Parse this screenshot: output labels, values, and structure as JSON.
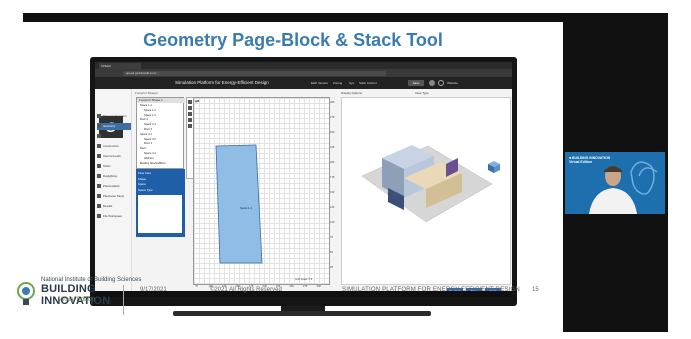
{
  "slide": {
    "title": "Geometry Page-Block & Stack Tool",
    "footer": {
      "org_small": "National Institute of Building Sciences",
      "org_big": "BUILDING INNOVATION",
      "edition": "Virtual Edition",
      "date": "9/17/2021",
      "copyright": "©2021 All Rights Reserved",
      "talk_title": "SIMULATION PLATFORM FOR ENERGY-EFFICIENT DESIGN",
      "page": "15"
    }
  },
  "browser": {
    "tab_label": "SPEED",
    "url": "speed.perkinswill.com/..."
  },
  "app": {
    "title": "Simulation Platform for Energy-Efficient Design",
    "header_items": [
      "EHP Version",
      "Zoning",
      "Sys",
      "Solar Control"
    ],
    "save_label": "Save",
    "user_label": "Website",
    "nav": [
      {
        "label": "Project Information",
        "active": false
      },
      {
        "label": "Geometry",
        "active": true
      },
      {
        "label": "Envelope",
        "active": false
      },
      {
        "label": "Construction",
        "active": false
      },
      {
        "label": "Internal Loads",
        "active": false
      },
      {
        "label": "HVAC",
        "active": false
      },
      {
        "label": "Daylighting",
        "active": false
      },
      {
        "label": "Photovoltaics",
        "active": false
      },
      {
        "label": "Parameter Study",
        "active": false
      },
      {
        "label": "Results",
        "active": false
      },
      {
        "label": "File Workspace",
        "active": false
      }
    ],
    "breadcrumb": "Footprint Shapes",
    "tree_header": "Footprint Shape 1",
    "tree_rows": [
      "Space 1-1",
      "Space 1-2",
      "Space 1-3",
      "Floor 2",
      "Space 2-1",
      "Floor 3",
      "Space 3-1",
      "Space 3-2",
      "Floor 4",
      "Roof",
      "Space 4-1",
      "Wall Ext",
      "Building Spaces/Blocs"
    ],
    "props_rows": [
      "Floor Area",
      "Shape",
      "Space",
      "Space Type"
    ],
    "display_options": "Display Options",
    "view_type_label": "View Type",
    "block_label": "Space 1-1",
    "x_ticks": [
      "75",
      "100",
      "125",
      "150",
      "175",
      "200",
      "225",
      "250",
      "275",
      "300"
    ],
    "y_ticks": [
      "300",
      "275",
      "250",
      "225",
      "200",
      "175",
      "150",
      "125",
      "100",
      "75",
      "50",
      "25"
    ],
    "scale_label": "Grid Scale: 5 ft",
    "buttons": [
      "Previous",
      "Save",
      "Next"
    ]
  },
  "colors": {
    "title_blue": "#3a7bb0",
    "nav_active": "#3a6ea5",
    "block_fill": "#8fbde6",
    "panel_blue": "#1f5fa8"
  }
}
